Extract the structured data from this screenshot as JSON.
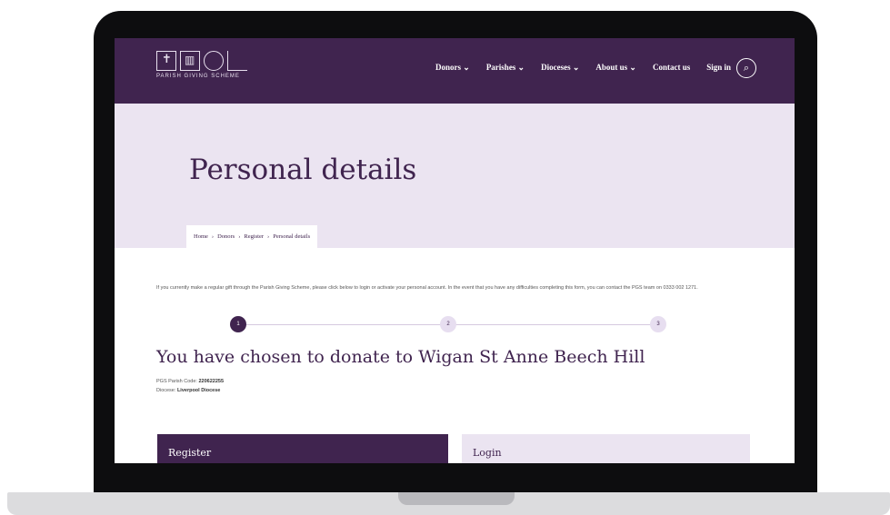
{
  "logo": {
    "text": "PARISH GIVING SCHEME"
  },
  "nav": {
    "items": [
      "Donors ⌄",
      "Parishes ⌄",
      "Dioceses ⌄",
      "About us ⌄",
      "Contact us",
      "Sign in"
    ],
    "search_icon": "⌕"
  },
  "hero": {
    "title": "Personal details",
    "breadcrumb": [
      "Home",
      "›",
      "Donors",
      "›",
      "Register",
      "›",
      "Personal details"
    ]
  },
  "intro_text": "If you currently make a regular gift through the Parish Giving Scheme, please click below to login or activate your personal account. In the event that you have any difficulties completing this form, you can contact the PGS team on 0333 002 1271.",
  "steps": [
    "1",
    "2",
    "3"
  ],
  "donate_heading": "You have chosen to donate to Wigan St Anne Beech Hill",
  "meta": {
    "code_label": "PGS Parish Code:",
    "code_value": "220622255",
    "diocese_label": "Diocese:",
    "diocese_value": "Liverpool Diocese"
  },
  "cards": {
    "register": "Register",
    "login": "Login"
  },
  "colors": {
    "brand": "#40244f",
    "light": "#ebe4f1"
  }
}
